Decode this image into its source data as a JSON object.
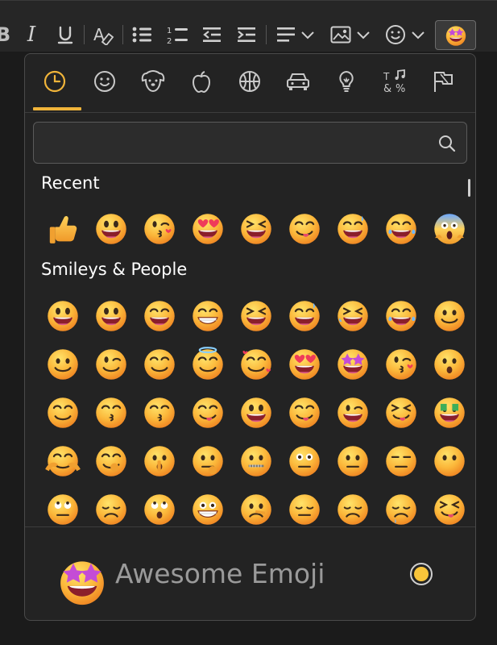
{
  "toolbar": {
    "items": [
      {
        "name": "bold",
        "glyph": "B"
      },
      {
        "name": "italic",
        "glyph": "I"
      },
      {
        "name": "underline",
        "glyph": "U"
      },
      {
        "name": "clear-format"
      },
      {
        "name": "bullet-list"
      },
      {
        "name": "numbered-list"
      },
      {
        "name": "outdent"
      },
      {
        "name": "indent"
      },
      {
        "name": "align"
      },
      {
        "name": "image"
      },
      {
        "name": "emoji"
      }
    ]
  },
  "picker": {
    "categories": [
      "recent",
      "smileys",
      "animals",
      "food",
      "activities",
      "travel",
      "objects",
      "symbols",
      "flags"
    ],
    "selected_category": "recent",
    "search": {
      "value": "",
      "placeholder": ""
    },
    "sections": [
      {
        "title": "Recent"
      },
      {
        "title": "Smileys & People"
      }
    ],
    "footer": {
      "name": "Awesome Emoji"
    },
    "skin_tone_color": "#f8c43a"
  },
  "colors": {
    "accent": "#f0b43a",
    "background": "#232323"
  }
}
